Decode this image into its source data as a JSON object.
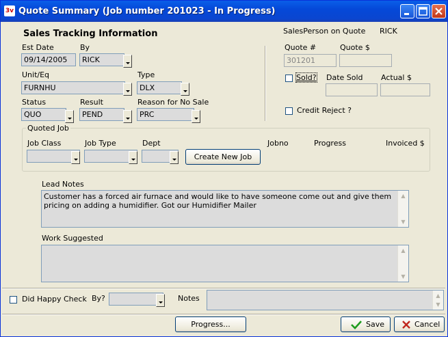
{
  "window": {
    "title": "Quote Summary  (Job number 201023 - In Progress)",
    "app_icon": "3v"
  },
  "section_title": "Sales Tracking Information",
  "salesperson": {
    "label": "SalesPerson on Quote",
    "value": "RICK"
  },
  "est_date": {
    "label": "Est Date",
    "value": "09/14/2005"
  },
  "by": {
    "label": "By",
    "value": "RICK"
  },
  "unit": {
    "label": "Unit/Eq",
    "value": "FURNHU"
  },
  "type": {
    "label": "Type",
    "value": "DLX"
  },
  "status": {
    "label": "Status",
    "value": "QUO"
  },
  "result": {
    "label": "Result",
    "value": "PEND"
  },
  "reason": {
    "label": "Reason for No Sale",
    "value": "PRC"
  },
  "quote_num": {
    "label": "Quote #",
    "value": "301201"
  },
  "quote_amt": {
    "label": "Quote $",
    "value": ""
  },
  "sold": {
    "label": "Sold?",
    "checked": false
  },
  "date_sold": {
    "label": "Date Sold",
    "value": ""
  },
  "actual": {
    "label": "Actual $",
    "value": ""
  },
  "credit_reject": {
    "label": "Credit Reject ?",
    "checked": false
  },
  "quoted_job": {
    "legend": "Quoted Job",
    "job_class_label": "Job Class",
    "job_type_label": "Job Type",
    "dept_label": "Dept",
    "create_button": "Create New Job",
    "jobno_label": "Jobno",
    "progress_label": "Progress",
    "invoiced_label": "Invoiced $"
  },
  "lead_notes": {
    "label": "Lead Notes",
    "text": "Customer has a forced air furnace and would like to have someone come out and give them pricing on adding a humidifier. Got our Humidifier Mailer"
  },
  "work_suggested": {
    "label": "Work Suggested",
    "text": ""
  },
  "happy_check": {
    "label": "Did Happy Check",
    "checked": false
  },
  "happy_by": {
    "label": "By?",
    "value": ""
  },
  "notes": {
    "label": "Notes",
    "value": ""
  },
  "buttons": {
    "progress": "Progress...",
    "save": "Save",
    "cancel": "Cancel"
  },
  "colors": {
    "titlebar": "#0548d8",
    "face": "#ece9d8",
    "save_check": "#1e9c1e",
    "cancel_x": "#c0281e"
  }
}
